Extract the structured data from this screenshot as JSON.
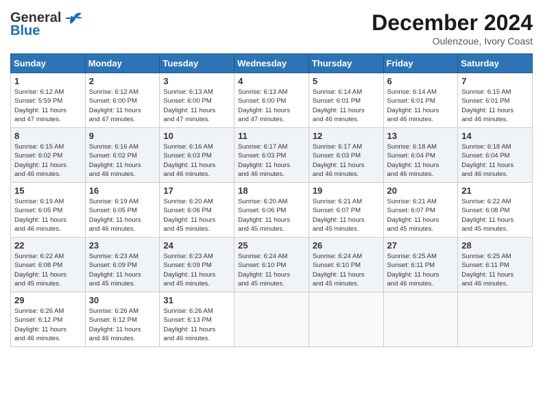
{
  "header": {
    "logo_general": "General",
    "logo_blue": "Blue",
    "month_year": "December 2024",
    "location": "Oulenzoue, Ivory Coast"
  },
  "days_of_week": [
    "Sunday",
    "Monday",
    "Tuesday",
    "Wednesday",
    "Thursday",
    "Friday",
    "Saturday"
  ],
  "weeks": [
    [
      {
        "day": "1",
        "detail": "Sunrise: 6:12 AM\nSunset: 5:59 PM\nDaylight: 11 hours\nand 47 minutes."
      },
      {
        "day": "2",
        "detail": "Sunrise: 6:12 AM\nSunset: 6:00 PM\nDaylight: 11 hours\nand 47 minutes."
      },
      {
        "day": "3",
        "detail": "Sunrise: 6:13 AM\nSunset: 6:00 PM\nDaylight: 11 hours\nand 47 minutes."
      },
      {
        "day": "4",
        "detail": "Sunrise: 6:13 AM\nSunset: 6:00 PM\nDaylight: 11 hours\nand 47 minutes."
      },
      {
        "day": "5",
        "detail": "Sunrise: 6:14 AM\nSunset: 6:01 PM\nDaylight: 11 hours\nand 46 minutes."
      },
      {
        "day": "6",
        "detail": "Sunrise: 6:14 AM\nSunset: 6:01 PM\nDaylight: 11 hours\nand 46 minutes."
      },
      {
        "day": "7",
        "detail": "Sunrise: 6:15 AM\nSunset: 6:01 PM\nDaylight: 11 hours\nand 46 minutes."
      }
    ],
    [
      {
        "day": "8",
        "detail": "Sunrise: 6:15 AM\nSunset: 6:02 PM\nDaylight: 11 hours\nand 46 minutes."
      },
      {
        "day": "9",
        "detail": "Sunrise: 6:16 AM\nSunset: 6:02 PM\nDaylight: 11 hours\nand 46 minutes."
      },
      {
        "day": "10",
        "detail": "Sunrise: 6:16 AM\nSunset: 6:03 PM\nDaylight: 11 hours\nand 46 minutes."
      },
      {
        "day": "11",
        "detail": "Sunrise: 6:17 AM\nSunset: 6:03 PM\nDaylight: 11 hours\nand 46 minutes."
      },
      {
        "day": "12",
        "detail": "Sunrise: 6:17 AM\nSunset: 6:03 PM\nDaylight: 11 hours\nand 46 minutes."
      },
      {
        "day": "13",
        "detail": "Sunrise: 6:18 AM\nSunset: 6:04 PM\nDaylight: 11 hours\nand 46 minutes."
      },
      {
        "day": "14",
        "detail": "Sunrise: 6:18 AM\nSunset: 6:04 PM\nDaylight: 11 hours\nand 46 minutes."
      }
    ],
    [
      {
        "day": "15",
        "detail": "Sunrise: 6:19 AM\nSunset: 6:05 PM\nDaylight: 11 hours\nand 46 minutes."
      },
      {
        "day": "16",
        "detail": "Sunrise: 6:19 AM\nSunset: 6:05 PM\nDaylight: 11 hours\nand 46 minutes."
      },
      {
        "day": "17",
        "detail": "Sunrise: 6:20 AM\nSunset: 6:06 PM\nDaylight: 11 hours\nand 45 minutes."
      },
      {
        "day": "18",
        "detail": "Sunrise: 6:20 AM\nSunset: 6:06 PM\nDaylight: 11 hours\nand 45 minutes."
      },
      {
        "day": "19",
        "detail": "Sunrise: 6:21 AM\nSunset: 6:07 PM\nDaylight: 11 hours\nand 45 minutes."
      },
      {
        "day": "20",
        "detail": "Sunrise: 6:21 AM\nSunset: 6:07 PM\nDaylight: 11 hours\nand 45 minutes."
      },
      {
        "day": "21",
        "detail": "Sunrise: 6:22 AM\nSunset: 6:08 PM\nDaylight: 11 hours\nand 45 minutes."
      }
    ],
    [
      {
        "day": "22",
        "detail": "Sunrise: 6:22 AM\nSunset: 6:08 PM\nDaylight: 11 hours\nand 45 minutes."
      },
      {
        "day": "23",
        "detail": "Sunrise: 6:23 AM\nSunset: 6:09 PM\nDaylight: 11 hours\nand 45 minutes."
      },
      {
        "day": "24",
        "detail": "Sunrise: 6:23 AM\nSunset: 6:09 PM\nDaylight: 11 hours\nand 45 minutes."
      },
      {
        "day": "25",
        "detail": "Sunrise: 6:24 AM\nSunset: 6:10 PM\nDaylight: 11 hours\nand 45 minutes."
      },
      {
        "day": "26",
        "detail": "Sunrise: 6:24 AM\nSunset: 6:10 PM\nDaylight: 11 hours\nand 45 minutes."
      },
      {
        "day": "27",
        "detail": "Sunrise: 6:25 AM\nSunset: 6:11 PM\nDaylight: 11 hours\nand 46 minutes."
      },
      {
        "day": "28",
        "detail": "Sunrise: 6:25 AM\nSunset: 6:11 PM\nDaylight: 11 hours\nand 46 minutes."
      }
    ],
    [
      {
        "day": "29",
        "detail": "Sunrise: 6:26 AM\nSunset: 6:12 PM\nDaylight: 11 hours\nand 46 minutes."
      },
      {
        "day": "30",
        "detail": "Sunrise: 6:26 AM\nSunset: 6:12 PM\nDaylight: 11 hours\nand 46 minutes."
      },
      {
        "day": "31",
        "detail": "Sunrise: 6:26 AM\nSunset: 6:13 PM\nDaylight: 11 hours\nand 46 minutes."
      },
      {
        "day": "",
        "detail": ""
      },
      {
        "day": "",
        "detail": ""
      },
      {
        "day": "",
        "detail": ""
      },
      {
        "day": "",
        "detail": ""
      }
    ]
  ]
}
